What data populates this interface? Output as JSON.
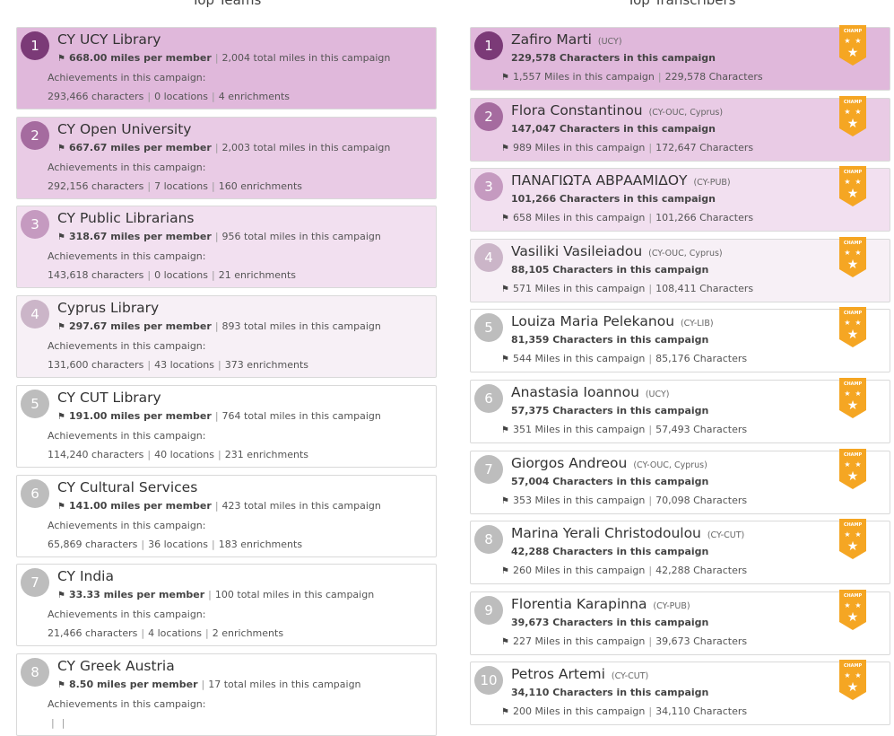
{
  "headings": {
    "teams": "Top Teams",
    "transcribers": "Top Transcribers"
  },
  "colors": {
    "rank1_bg": "#e0b8db",
    "rank2_bg": "#e9cbe5",
    "rank3_bg": "#f2e0f0",
    "rank4_bg": "#f7f0f6",
    "badge1": "#7b3a77",
    "badge2": "#a56b9f",
    "badge3": "#c59ac0",
    "badge4": "#cbb5c8",
    "badge_rest": "#bdbdbd",
    "champ_gold": "#f5a623"
  },
  "achievements_label": "Achievements in this campaign:",
  "teams": [
    {
      "rank": "1",
      "name": "CY UCY Library",
      "miles_per_member": "668.00 miles per member",
      "total_miles": "2,004 total miles in this campaign",
      "characters": "293,466 characters",
      "locations": "0 locations",
      "enrichments": "4 enrichments"
    },
    {
      "rank": "2",
      "name": "CY Open University",
      "miles_per_member": "667.67 miles per member",
      "total_miles": "2,003 total miles in this campaign",
      "characters": "292,156 characters",
      "locations": "7 locations",
      "enrichments": "160 enrichments"
    },
    {
      "rank": "3",
      "name": "CY Public Librarians",
      "miles_per_member": "318.67 miles per member",
      "total_miles": "956 total miles in this campaign",
      "characters": "143,618 characters",
      "locations": "0 locations",
      "enrichments": "21 enrichments"
    },
    {
      "rank": "4",
      "name": "Cyprus Library",
      "miles_per_member": "297.67 miles per member",
      "total_miles": "893 total miles in this campaign",
      "characters": "131,600 characters",
      "locations": "43 locations",
      "enrichments": "373 enrichments"
    },
    {
      "rank": "5",
      "name": "CY CUT Library",
      "miles_per_member": "191.00 miles per member",
      "total_miles": "764 total miles in this campaign",
      "characters": "114,240 characters",
      "locations": "40 locations",
      "enrichments": "231 enrichments"
    },
    {
      "rank": "6",
      "name": "CY Cultural Services",
      "miles_per_member": "141.00 miles per member",
      "total_miles": "423 total miles in this campaign",
      "characters": "65,869 characters",
      "locations": "36 locations",
      "enrichments": "183 enrichments"
    },
    {
      "rank": "7",
      "name": "CY India",
      "miles_per_member": "33.33 miles per member",
      "total_miles": "100 total miles in this campaign",
      "characters": "21,466 characters",
      "locations": "4 locations",
      "enrichments": "2 enrichments"
    },
    {
      "rank": "8",
      "name": "CY Greek Austria",
      "miles_per_member": "8.50 miles per member",
      "total_miles": "17 total miles in this campaign",
      "characters": "",
      "locations": "",
      "enrichments": ""
    }
  ],
  "transcribers": [
    {
      "rank": "1",
      "name": "Zafiro Marti",
      "team": "(UCY)",
      "campaign_chars": "229,578 Characters in this campaign",
      "miles": "1,557 Miles in this campaign",
      "total_chars": "229,578 Characters"
    },
    {
      "rank": "2",
      "name": "Flora Constantinou",
      "team": "(CY-OUC, Cyprus)",
      "campaign_chars": "147,047 Characters in this campaign",
      "miles": "989 Miles in this campaign",
      "total_chars": "172,647 Characters"
    },
    {
      "rank": "3",
      "name": "ΠΑΝΑΓΙΩΤΑ ΑΒΡΑΑΜΙΔΟΥ",
      "team": "(CY-PUB)",
      "campaign_chars": "101,266 Characters in this campaign",
      "miles": "658 Miles in this campaign",
      "total_chars": "101,266 Characters"
    },
    {
      "rank": "4",
      "name": "Vasiliki Vasileiadou",
      "team": "(CY-OUC, Cyprus)",
      "campaign_chars": "88,105 Characters in this campaign",
      "miles": "571 Miles in this campaign",
      "total_chars": "108,411 Characters"
    },
    {
      "rank": "5",
      "name": "Louiza Maria Pelekanou",
      "team": "(CY-LIB)",
      "campaign_chars": "81,359 Characters in this campaign",
      "miles": "544 Miles in this campaign",
      "total_chars": "85,176 Characters"
    },
    {
      "rank": "6",
      "name": "Anastasia Ioannou",
      "team": "(UCY)",
      "campaign_chars": "57,375 Characters in this campaign",
      "miles": "351 Miles in this campaign",
      "total_chars": "57,493 Characters"
    },
    {
      "rank": "7",
      "name": "Giorgos Andreou",
      "team": "(CY-OUC, Cyprus)",
      "campaign_chars": "57,004 Characters in this campaign",
      "miles": "353 Miles in this campaign",
      "total_chars": "70,098 Characters"
    },
    {
      "rank": "8",
      "name": "Marina Yerali Christodoulou",
      "team": "(CY-CUT)",
      "campaign_chars": "42,288 Characters in this campaign",
      "miles": "260 Miles in this campaign",
      "total_chars": "42,288 Characters"
    },
    {
      "rank": "9",
      "name": "Florentia Karapinna",
      "team": "(CY-PUB)",
      "campaign_chars": "39,673 Characters in this campaign",
      "miles": "227 Miles in this campaign",
      "total_chars": "39,673 Characters"
    },
    {
      "rank": "10",
      "name": "Petros Artemi",
      "team": "(CY-CUT)",
      "campaign_chars": "34,110 Characters in this campaign",
      "miles": "200 Miles in this campaign",
      "total_chars": "34,110 Characters"
    }
  ],
  "champ_label": "CHAMP"
}
